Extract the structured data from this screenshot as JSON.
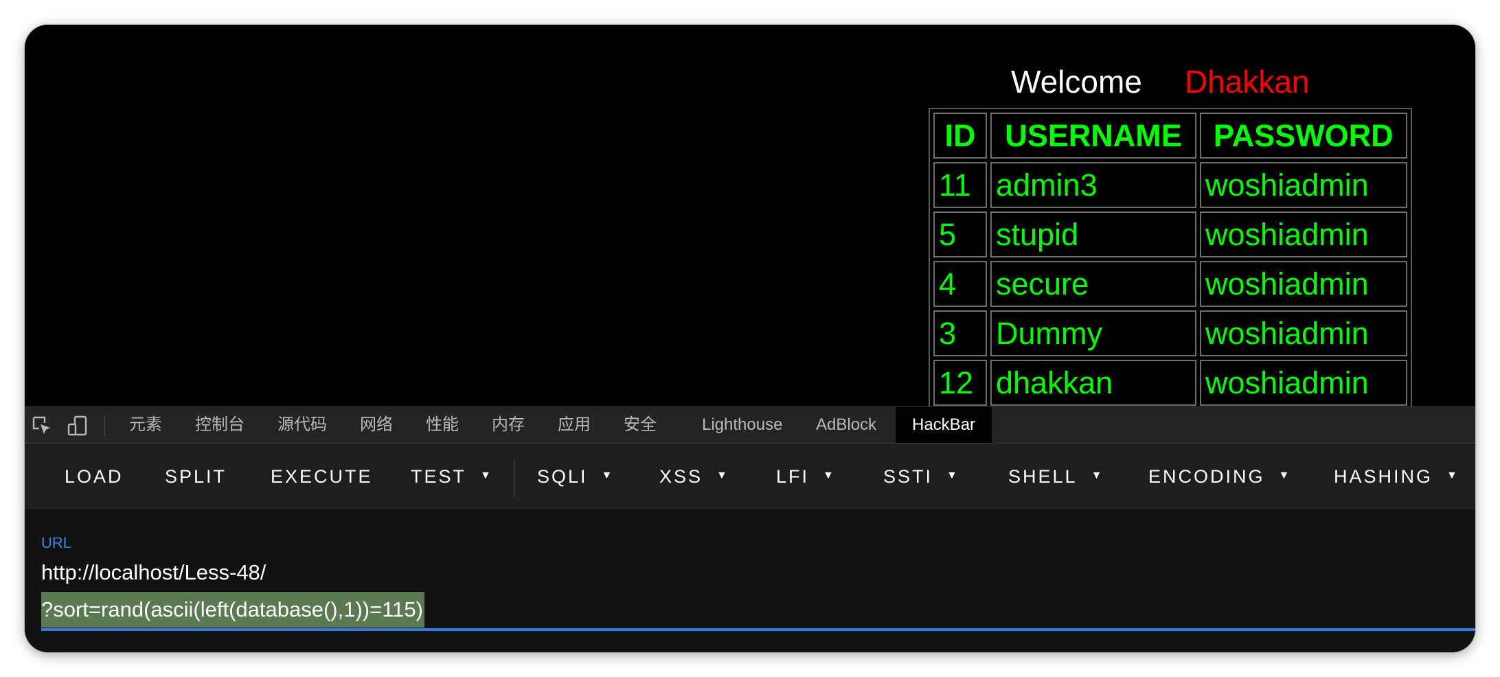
{
  "page": {
    "welcome_label": "Welcome",
    "welcome_name": "Dhakkan",
    "welcome_color": "#ff0000",
    "table": {
      "headers": [
        "ID",
        "USERNAME",
        "PASSWORD"
      ],
      "rows": [
        [
          "11",
          "admin3",
          "woshiadmin"
        ],
        [
          "5",
          "stupid",
          "woshiadmin"
        ],
        [
          "4",
          "secure",
          "woshiadmin"
        ],
        [
          "3",
          "Dummy",
          "woshiadmin"
        ],
        [
          "12",
          "dhakkan",
          "woshiadmin"
        ]
      ],
      "text_color": "#00ff00"
    }
  },
  "devtools": {
    "tabs": [
      "元素",
      "控制台",
      "源代码",
      "网络",
      "性能",
      "内存",
      "应用",
      "安全",
      "Lighthouse",
      "AdBlock",
      "HackBar"
    ],
    "active_tab": "HackBar",
    "icons": [
      "inspect-element-icon",
      "device-toolbar-icon"
    ]
  },
  "hackbar": {
    "buttons": [
      {
        "label": "LOAD",
        "dropdown": false
      },
      {
        "label": "SPLIT",
        "dropdown": false
      },
      {
        "label": "EXECUTE",
        "dropdown": false
      },
      {
        "label": "TEST",
        "dropdown": true
      },
      {
        "label": "SQLI",
        "dropdown": true
      },
      {
        "label": "XSS",
        "dropdown": true
      },
      {
        "label": "LFI",
        "dropdown": true
      },
      {
        "label": "SSTI",
        "dropdown": true
      },
      {
        "label": "SHELL",
        "dropdown": true
      },
      {
        "label": "ENCODING",
        "dropdown": true
      },
      {
        "label": "HASHING",
        "dropdown": true
      }
    ],
    "caret_glyph": "▼",
    "url_label": "URL",
    "url_line1": "http://localhost/Less-48/",
    "url_line2": "?sort=rand(ascii(left(database(),1))=115)",
    "accent_color": "#2e7fe0",
    "selection_color": "#5b7a51"
  }
}
